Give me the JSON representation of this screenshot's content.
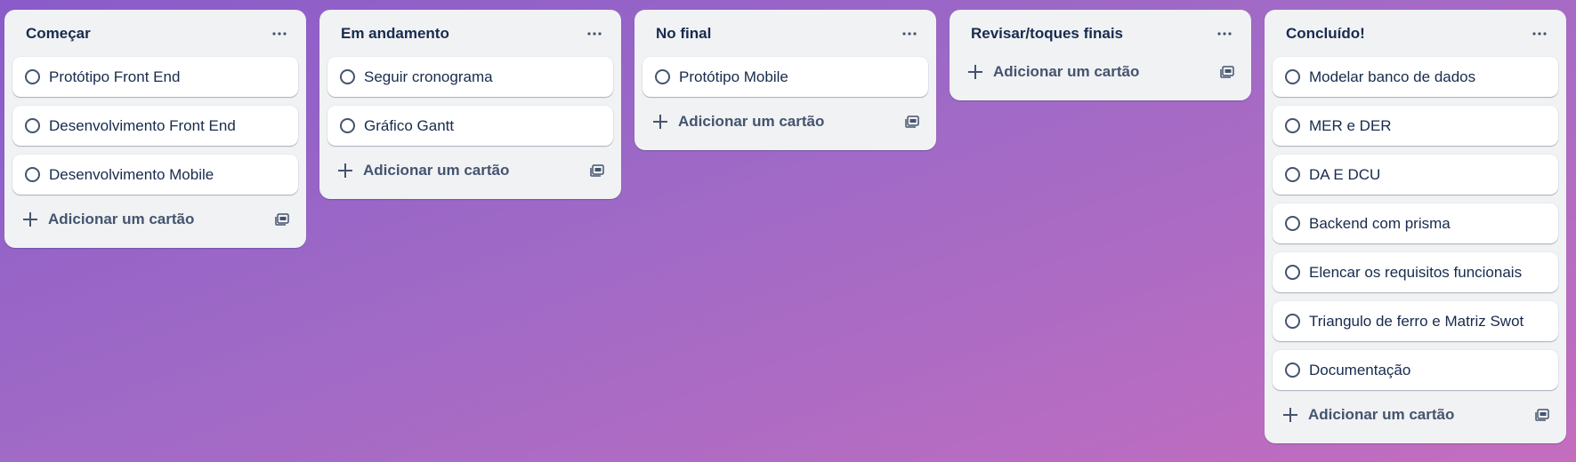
{
  "board": {
    "lists": [
      {
        "title": "Começar",
        "cards": [
          "Protótipo Front End",
          "Desenvolvimento Front End",
          "Desenvolvimento Mobile"
        ],
        "add_label": "Adicionar um cartão"
      },
      {
        "title": "Em andamento",
        "cards": [
          "Seguir cronograma",
          "Gráfico Gantt"
        ],
        "add_label": "Adicionar um cartão"
      },
      {
        "title": "No final",
        "cards": [
          "Protótipo Mobile"
        ],
        "add_label": "Adicionar um cartão"
      },
      {
        "title": "Revisar/toques finais",
        "cards": [],
        "add_label": "Adicionar um cartão"
      },
      {
        "title": "Concluído!",
        "cards": [
          "Modelar banco de dados",
          "MER e DER",
          "DA E DCU",
          "Backend com prisma",
          "Elencar os requisitos funcionais",
          "Triangulo de ferro e Matriz Swot",
          "Documentação"
        ],
        "add_label": "Adicionar um cartão"
      }
    ]
  },
  "icons": {
    "list_menu": "more-horizontal-icon",
    "card_status": "circle-checkbox-icon",
    "add": "plus-icon",
    "template": "card-template-icon"
  },
  "colors": {
    "background_start": "#8a5cc9",
    "background_end": "#c46dbf",
    "list_bg": "#f1f2f4",
    "card_bg": "#ffffff",
    "text": "#172b4d",
    "muted": "#44546f"
  }
}
